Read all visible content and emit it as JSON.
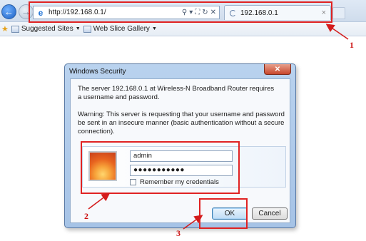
{
  "browser": {
    "address_url": "http://192.168.0.1/",
    "tab_title": "192.168.0.1",
    "tab_close": "×",
    "tools": {
      "search": "⚲",
      "dropdown": "▾",
      "compat": "⛶",
      "refresh": "↻",
      "stop": "✕"
    }
  },
  "favorites_bar": {
    "items": [
      {
        "label": "Suggested Sites",
        "icon": "suggested-sites-icon"
      },
      {
        "label": "Web Slice Gallery",
        "icon": "web-slice-icon"
      }
    ]
  },
  "dialog": {
    "title": "Windows Security",
    "close_label": "✕",
    "message": "The server 192.168.0.1 at Wireless-N Broadband Router requires a username and password.",
    "warning": "Warning: This server is requesting that your username and password be sent in an insecure manner (basic authentication without a secure connection).",
    "username_value": "admin",
    "password_mask": "●●●●●●●●●●●",
    "remember_label": "Remember my credentials",
    "ok_label": "OK",
    "cancel_label": "Cancel"
  },
  "annotations": {
    "callout_1": "1",
    "callout_2": "2",
    "callout_3": "3",
    "color": "#e02222"
  }
}
